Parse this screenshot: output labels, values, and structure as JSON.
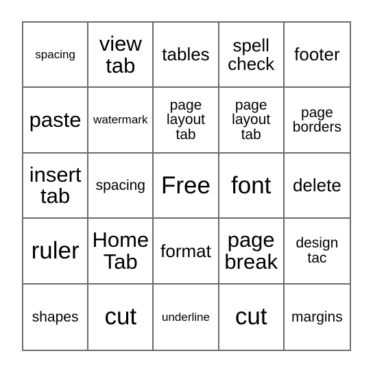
{
  "card": {
    "type": "bingo-card",
    "columns": 5,
    "rows": 5,
    "free_space_label": "Free",
    "border_color": "#6b6b6b",
    "text_color": "#000000",
    "background_color": "#ffffff",
    "cells": [
      {
        "text": "spacing",
        "size": "sm",
        "free": false
      },
      {
        "text": "view\ntab",
        "size": "xl",
        "free": false
      },
      {
        "text": "tables",
        "size": "lg",
        "free": false
      },
      {
        "text": "spell\ncheck",
        "size": "lg",
        "free": false
      },
      {
        "text": "footer",
        "size": "lg",
        "free": false
      },
      {
        "text": "paste",
        "size": "xl",
        "free": false
      },
      {
        "text": "watermark",
        "size": "sm",
        "free": false
      },
      {
        "text": "page\nlayout\ntab",
        "size": "md",
        "free": false
      },
      {
        "text": "page\nlayout\ntab",
        "size": "md",
        "free": false
      },
      {
        "text": "page\nborders",
        "size": "md",
        "free": false
      },
      {
        "text": "insert\ntab",
        "size": "xl",
        "free": false
      },
      {
        "text": "spacing",
        "size": "md",
        "free": false
      },
      {
        "text": "Free",
        "size": "xxl",
        "free": true
      },
      {
        "text": "font",
        "size": "xxl",
        "free": false
      },
      {
        "text": "delete",
        "size": "lg",
        "free": false
      },
      {
        "text": "ruler",
        "size": "xxl",
        "free": false
      },
      {
        "text": "Home\nTab",
        "size": "xl",
        "free": false
      },
      {
        "text": "format",
        "size": "lg",
        "free": false
      },
      {
        "text": "page\nbreak",
        "size": "xl",
        "free": false
      },
      {
        "text": "design\ntac",
        "size": "md",
        "free": false
      },
      {
        "text": "shapes",
        "size": "md",
        "free": false
      },
      {
        "text": "cut",
        "size": "xxl",
        "free": false
      },
      {
        "text": "underline",
        "size": "sm",
        "free": false
      },
      {
        "text": "cut",
        "size": "xxl",
        "free": false
      },
      {
        "text": "margins",
        "size": "md",
        "free": false
      }
    ]
  }
}
